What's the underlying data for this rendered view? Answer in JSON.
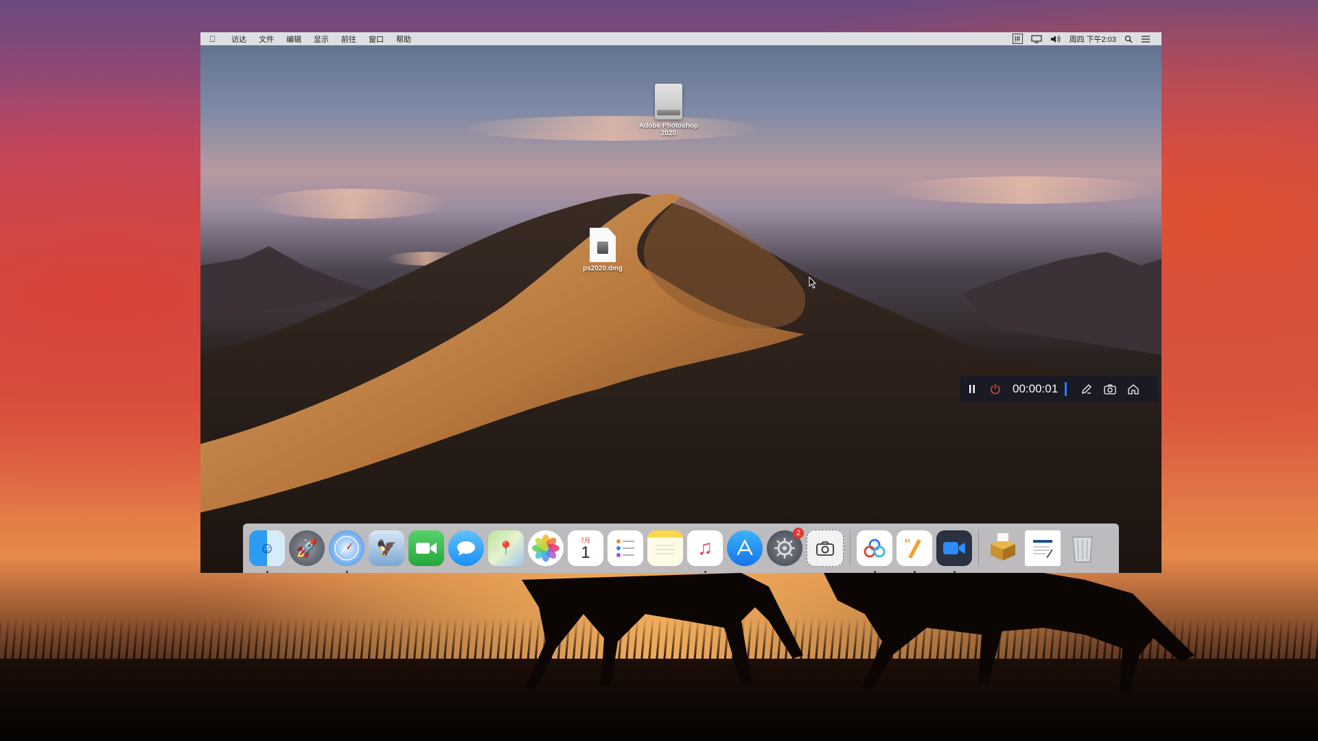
{
  "menubar": {
    "apple_icon": "apple-logo-icon",
    "items": [
      "访达",
      "文件",
      "编辑",
      "显示",
      "前往",
      "窗口",
      "帮助"
    ],
    "status": {
      "input_method": "拼",
      "display_icon": "display-mirror-icon",
      "volume_icon": "volume-icon",
      "clock": "周四 下午2:03",
      "spotlight_icon": "search-icon",
      "notification_icon": "list-icon"
    }
  },
  "desktop_icons": [
    {
      "label": "Adobe Photoshop 2020",
      "icon": "disk-image-volume-icon"
    },
    {
      "label": "ps2020.dmg",
      "icon": "dmg-file-icon"
    }
  ],
  "recorder": {
    "pause_icon": "pause-icon",
    "stop_icon": "power-icon",
    "time": "00:00:01",
    "pen_icon": "pen-icon",
    "camera_icon": "camera-icon",
    "home_icon": "home-icon"
  },
  "dock": {
    "items": [
      {
        "name": "finder",
        "icon": "finder-icon",
        "running": true
      },
      {
        "name": "launchpad",
        "icon": "launchpad-icon",
        "running": false
      },
      {
        "name": "safari",
        "icon": "safari-icon",
        "running": true
      },
      {
        "name": "mail",
        "icon": "mail-icon",
        "running": false
      },
      {
        "name": "facetime",
        "icon": "facetime-icon",
        "running": false
      },
      {
        "name": "messages",
        "icon": "messages-icon",
        "running": false
      },
      {
        "name": "maps",
        "icon": "maps-icon",
        "running": false
      },
      {
        "name": "photos",
        "icon": "photos-icon",
        "running": false
      },
      {
        "name": "calendar",
        "icon": "calendar-icon",
        "running": false,
        "month": "7月",
        "day": "1"
      },
      {
        "name": "reminders",
        "icon": "reminders-icon",
        "running": false
      },
      {
        "name": "notes",
        "icon": "notes-icon",
        "running": false
      },
      {
        "name": "music",
        "icon": "music-icon",
        "running": true
      },
      {
        "name": "app-store",
        "icon": "app-store-icon",
        "running": false
      },
      {
        "name": "system-preferences",
        "icon": "gear-icon",
        "running": false,
        "badge": "2"
      },
      {
        "name": "screenshot",
        "icon": "screenshot-icon",
        "running": false
      },
      {
        "name": "baidu-netdisk",
        "icon": "cloud-rings-icon",
        "running": true
      },
      {
        "name": "pages",
        "icon": "pen-document-icon",
        "running": true
      },
      {
        "name": "zoom",
        "icon": "video-camera-icon",
        "running": true
      },
      {
        "name": "installer",
        "icon": "package-icon",
        "running": false
      },
      {
        "name": "document",
        "icon": "document-icon",
        "running": false
      },
      {
        "name": "trash",
        "icon": "trash-icon",
        "running": false
      }
    ]
  }
}
